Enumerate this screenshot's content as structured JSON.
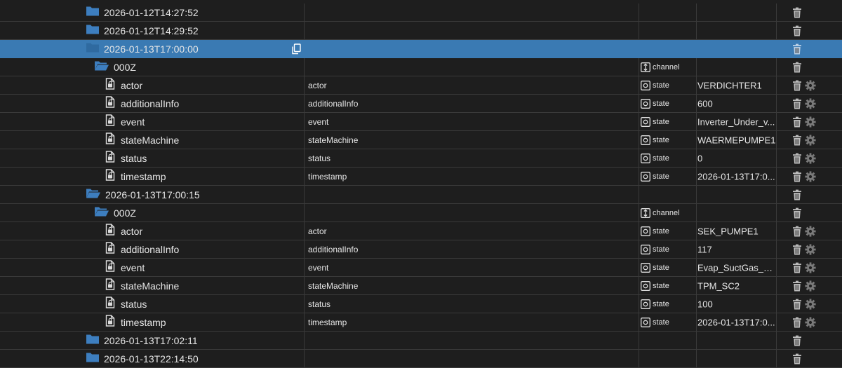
{
  "colors": {
    "selected_row": "#3a7ab3",
    "folder": "#3d7ebf",
    "background": "#1e1e1e"
  },
  "icons": {
    "folder": "folder-icon",
    "folder_open": "folder-open-icon",
    "state": "state-file-icon",
    "type_state": "state-type-icon",
    "type_channel": "channel-type-icon",
    "trash": "trash-icon",
    "gear": "gear-icon",
    "copy": "copy-icon"
  },
  "rows": [
    {
      "kind": "folder",
      "indent": 0,
      "open": false,
      "name": "2026-01-12T14:27:52",
      "label": "",
      "type": "",
      "value": ""
    },
    {
      "kind": "folder",
      "indent": 0,
      "open": false,
      "name": "2026-01-12T14:29:52",
      "label": "",
      "type": "",
      "value": ""
    },
    {
      "kind": "folder",
      "indent": 0,
      "open": false,
      "name": "2026-01-13T17:00:00",
      "label": "",
      "type": "",
      "value": "",
      "selected": true,
      "copy": true
    },
    {
      "kind": "folder",
      "indent": 1,
      "open": true,
      "name": "000Z",
      "label": "",
      "type": "channel",
      "value": ""
    },
    {
      "kind": "state",
      "indent": 2,
      "name": "actor",
      "label": "actor",
      "type": "state",
      "value": "VERDICHTER1"
    },
    {
      "kind": "state",
      "indent": 2,
      "name": "additionalInfo",
      "label": "additionalInfo",
      "type": "state",
      "value": "600"
    },
    {
      "kind": "state",
      "indent": 2,
      "name": "event",
      "label": "event",
      "type": "state",
      "value": "Inverter_Under_v..."
    },
    {
      "kind": "state",
      "indent": 2,
      "name": "stateMachine",
      "label": "stateMachine",
      "type": "state",
      "value": "WAERMEPUMPE1"
    },
    {
      "kind": "state",
      "indent": 2,
      "name": "status",
      "label": "status",
      "type": "state",
      "value": "0"
    },
    {
      "kind": "state",
      "indent": 2,
      "name": "timestamp",
      "label": "timestamp",
      "type": "state",
      "value": "2026-01-13T17:0..."
    },
    {
      "kind": "folder",
      "indent": 0,
      "open": true,
      "name": "2026-01-13T17:00:15",
      "label": "",
      "type": "",
      "value": ""
    },
    {
      "kind": "folder",
      "indent": 1,
      "open": true,
      "name": "000Z",
      "label": "",
      "type": "channel",
      "value": ""
    },
    {
      "kind": "state",
      "indent": 2,
      "name": "actor",
      "label": "actor",
      "type": "state",
      "value": "SEK_PUMPE1"
    },
    {
      "kind": "state",
      "indent": 2,
      "name": "additionalInfo",
      "label": "additionalInfo",
      "type": "state",
      "value": "117"
    },
    {
      "kind": "state",
      "indent": 2,
      "name": "event",
      "label": "event",
      "type": "state",
      "value": "Evap_SuctGas_T ..."
    },
    {
      "kind": "state",
      "indent": 2,
      "name": "stateMachine",
      "label": "stateMachine",
      "type": "state",
      "value": "TPM_SC2"
    },
    {
      "kind": "state",
      "indent": 2,
      "name": "status",
      "label": "status",
      "type": "state",
      "value": "100"
    },
    {
      "kind": "state",
      "indent": 2,
      "name": "timestamp",
      "label": "timestamp",
      "type": "state",
      "value": "2026-01-13T17:0..."
    },
    {
      "kind": "folder",
      "indent": 0,
      "open": false,
      "name": "2026-01-13T17:02:11",
      "label": "",
      "type": "",
      "value": ""
    },
    {
      "kind": "folder",
      "indent": 0,
      "open": false,
      "name": "2026-01-13T22:14:50",
      "label": "",
      "type": "",
      "value": ""
    }
  ]
}
